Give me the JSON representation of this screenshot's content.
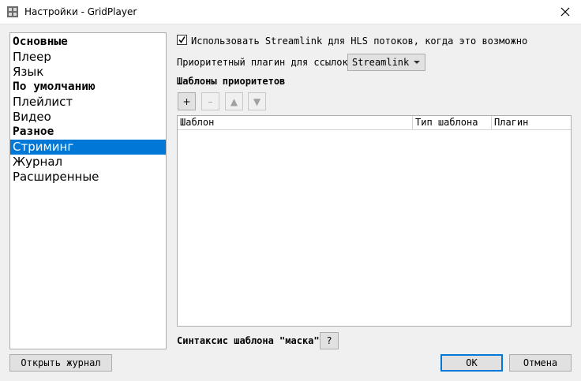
{
  "window": {
    "title": "Настройки - GridPlayer"
  },
  "sidebar": {
    "items": [
      {
        "label": "Основные",
        "type": "header"
      },
      {
        "label": "Плеер",
        "type": "item"
      },
      {
        "label": "Язык",
        "type": "item"
      },
      {
        "label": "По умолчанию",
        "type": "header"
      },
      {
        "label": "Плейлист",
        "type": "item"
      },
      {
        "label": "Видео",
        "type": "item"
      },
      {
        "label": "Разное",
        "type": "header"
      },
      {
        "label": "Стриминг",
        "type": "item",
        "selected": true
      },
      {
        "label": "Журнал",
        "type": "item"
      },
      {
        "label": "Расширенные",
        "type": "item"
      }
    ]
  },
  "streaming": {
    "use_streamlink_label": "Использовать Streamlink для HLS потоков, когда это возможно",
    "use_streamlink_checked": true,
    "priority_plugin_label": "Приоритетный плагин для ссылок",
    "priority_plugin_value": "Streamlink",
    "templates_section_title": "Шаблоны приоритетов",
    "toolbar": {
      "add": "+",
      "remove": "–",
      "move_up": "▲",
      "move_down": "▼"
    },
    "table": {
      "columns": [
        "Шаблон",
        "Тип шаблона",
        "Плагин"
      ],
      "rows": []
    },
    "mask_syntax_label": "Синтаксис шаблона \"маска\"",
    "mask_syntax_help": "?"
  },
  "footer": {
    "open_log_label": "Открыть журнал",
    "ok_label": "OK",
    "cancel_label": "Отмена"
  },
  "colors": {
    "selection": "#0078d7",
    "window_bg": "#f0f0f0",
    "button_bg": "#e1e1e1"
  }
}
